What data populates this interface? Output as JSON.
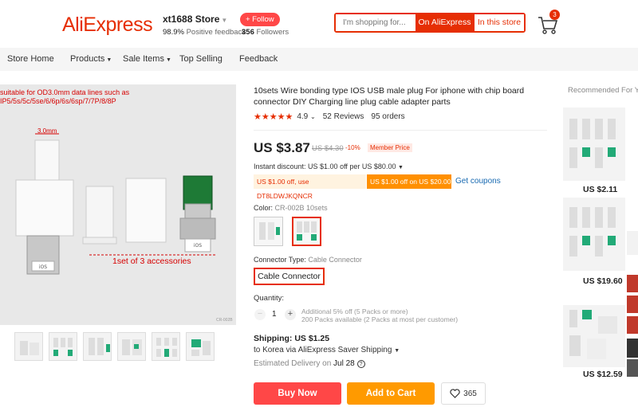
{
  "header": {
    "logo": "AliExpress",
    "store_name": "xt1688 Store",
    "feedback_percent": "98.9%",
    "feedback_label": "Positive feedback",
    "follow_label": "+ Follow",
    "followers_count": "356",
    "followers_label": "Followers",
    "search_placeholder": "I'm shopping for...",
    "search_aliexpress": "On AliExpress",
    "search_store": "In this store",
    "cart_count": "3"
  },
  "nav": {
    "items": [
      "Store Home",
      "Products",
      "Sale Items",
      "Top Selling",
      "Feedback"
    ]
  },
  "image": {
    "caption_line1": "suitable for OD3.0mm data lines such as",
    "caption_line2": "IP5/5s/5c/5se/6/6p/6s/6sp/7/7P/8/8P",
    "dimension": "3.0mm",
    "accessories": "1set of 3 accessories",
    "code": "CR-002B"
  },
  "product": {
    "title": "10sets Wire bonding type IOS USB male plug For iphone with chip board connector DIY Charging line plug cable adapter parts",
    "rating": "4.9",
    "reviews": "52 Reviews",
    "orders": "95 orders",
    "price": "US $3.87",
    "original_price": "US $4.30",
    "discount": "-10%",
    "member_price": "Member Price",
    "instant_discount": "Instant discount: US $1.00 off per US $80.00",
    "coupon_code": "US $1.00 off, use DT8LDWJKQNCR",
    "coupon_offer": "US $1.00 off on US $20.00",
    "get_coupons": "Get coupons",
    "color_label": "Color:",
    "color_value": "CR-002B 10sets",
    "connector_label": "Connector Type:",
    "connector_value": "Cable Connector",
    "connector_option": "Cable Connector",
    "quantity_label": "Quantity:",
    "quantity": "1",
    "qty_info1": "Additional 5% off (5 Packs or more)",
    "qty_info2": "200 Packs available (2 Packs at most per customer)",
    "shipping": "Shipping: US $1.25",
    "ship_to": "to Korea via AliExpress Saver Shipping",
    "delivery_label": "Estimated Delivery on",
    "delivery_date": "Jul 28",
    "buy_now": "Buy Now",
    "add_to_cart": "Add to Cart",
    "wishlist_count": "365"
  },
  "recommended": {
    "title": "Recommended For You",
    "prices": [
      "US $2.11",
      "US $19.60",
      "US $12.59"
    ]
  },
  "colors": {
    "brand": "#e62e04",
    "buy": "#ff4747",
    "cart": "#ff9a00",
    "link": "#1769b1"
  }
}
